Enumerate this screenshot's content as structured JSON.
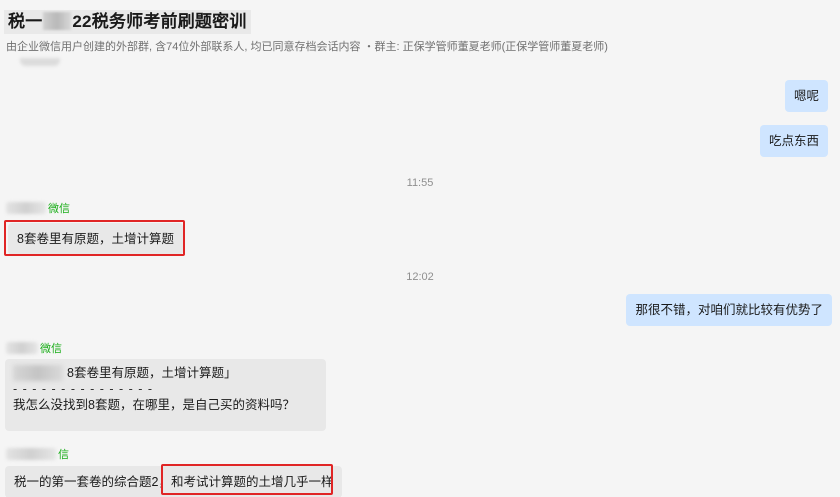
{
  "header": {
    "title_prefix": "税一",
    "title_suffix": "22税务师考前刷题密训",
    "subtitle": "由企业微信用户创建的外部群, 含74位外部联系人, 均已同意存档会话内容 ・群主: 正保学管师董夏老师(正保学管师董夏老师)"
  },
  "messages": {
    "m1": "嗯呢",
    "m2": "吃点东西",
    "time1": "11:55",
    "sender1": "微信",
    "m3": "8套卷里有原题，土增计算题",
    "time2": "12:02",
    "m4": "那很不错，对咱们就比较有优势了",
    "sender2": "微信",
    "quote_text": "8套卷里有原题，土增计算题」",
    "quote_divider": "- - - - - - - - - - - - - - -",
    "m5": "我怎么没找到8套题，在哪里，是自己买的资料吗？",
    "sender3": "信",
    "m6": "税一的第一套卷的综合题2，和考试计算题的土增几乎一样"
  },
  "colors": {
    "right_bubble": "#cfe5ff",
    "left_bubble": "#e8e8e8",
    "highlight": "#e02525",
    "sender_tag": "#1aad19"
  }
}
